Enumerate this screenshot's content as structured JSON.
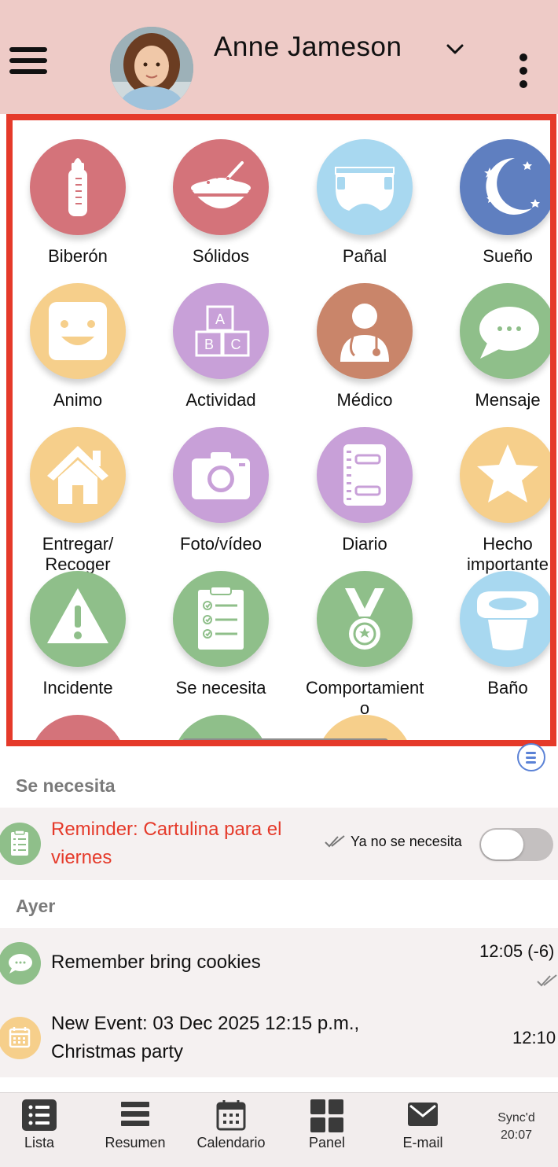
{
  "header": {
    "child_name": "Anne Jameson"
  },
  "grid": [
    {
      "label": "Biberón",
      "icon": "bottle-icon",
      "color": "#d4737a"
    },
    {
      "label": "Sólidos",
      "icon": "bowl-icon",
      "color": "#d4737a"
    },
    {
      "label": "Pañal",
      "icon": "diaper-icon",
      "color": "#a8d8f0"
    },
    {
      "label": "Sueño",
      "icon": "moon-stars-icon",
      "color": "#5f7fc0"
    },
    {
      "label": "Animo",
      "icon": "smiley-icon",
      "color": "#f6cf8b"
    },
    {
      "label": "Actividad",
      "icon": "abc-blocks-icon",
      "color": "#c8a0d8"
    },
    {
      "label": "Médico",
      "icon": "doctor-icon",
      "color": "#c9856a"
    },
    {
      "label": "Mensaje",
      "icon": "chat-bubble-icon",
      "color": "#8fbf8a"
    },
    {
      "label": "Entregar/ Recoger",
      "icon": "house-icon",
      "color": "#f6cf8b"
    },
    {
      "label": "Foto/vídeo",
      "icon": "camera-icon",
      "color": "#c8a0d8"
    },
    {
      "label": "Diario",
      "icon": "notebook-icon",
      "color": "#c8a0d8"
    },
    {
      "label": "Hecho importante",
      "icon": "star-icon",
      "color": "#f6cf8b"
    },
    {
      "label": "Incidente",
      "icon": "warning-icon",
      "color": "#8fbf8a"
    },
    {
      "label": "Se necesita",
      "icon": "checklist-icon",
      "color": "#8fbf8a"
    },
    {
      "label": "Comportamient o",
      "icon": "medal-icon",
      "color": "#8fbf8a"
    },
    {
      "label": "Baño",
      "icon": "potty-icon",
      "color": "#a8d8f0"
    }
  ],
  "partial_row_colors": [
    "#d4737a",
    "#8fbf8a",
    "#f6cf8b"
  ],
  "sections": {
    "needed": {
      "title": "Se necesita",
      "item_text": "Reminder: Cartulina para el viernes",
      "toggle_label": "Ya no se necesita",
      "toggle_on": false
    },
    "yesterday": {
      "title": "Ayer",
      "items": [
        {
          "text": "Remember bring cookies",
          "time": "12:05 (-6)"
        },
        {
          "text": "New Event: 03 Dec 2025 12:15 p.m., Christmas party",
          "time": "12:10"
        }
      ]
    }
  },
  "bottom_nav": {
    "items": [
      {
        "label": "Lista",
        "icon": "list-icon"
      },
      {
        "label": "Resumen",
        "icon": "summary-icon"
      },
      {
        "label": "Calendario",
        "icon": "calendar-icon"
      },
      {
        "label": "Panel",
        "icon": "dashboard-icon"
      },
      {
        "label": "E-mail",
        "icon": "mail-icon"
      }
    ],
    "sync_line1": "Sync'd",
    "sync_line2": "20:07"
  },
  "colors": {
    "header_bg": "#eecbc7",
    "highlight_border": "#e53a2a",
    "reminder_red": "#e53a2a",
    "row_bg": "#f5f1f1"
  }
}
